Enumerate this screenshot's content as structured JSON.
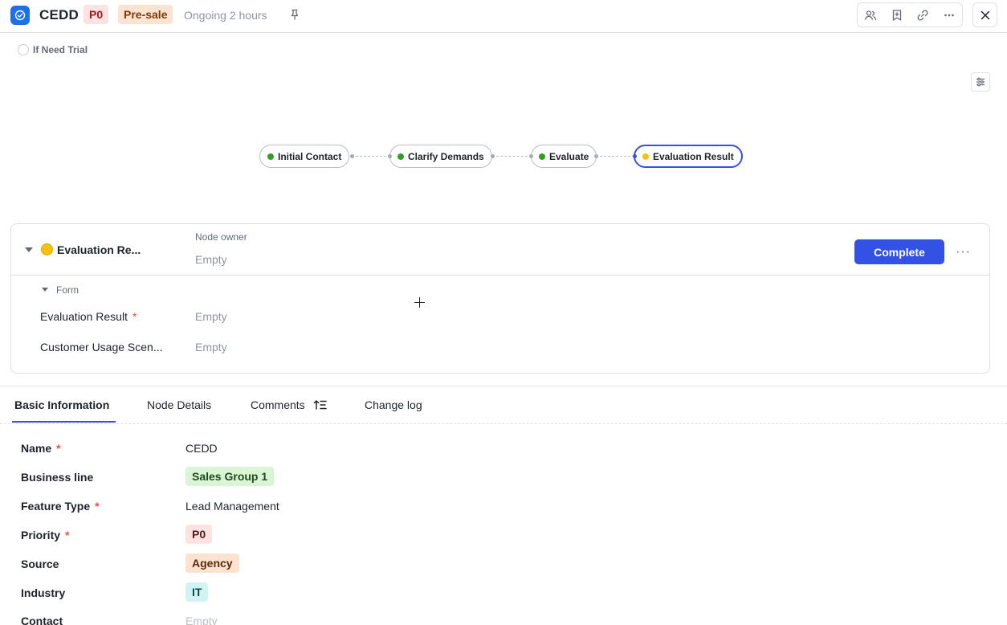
{
  "header": {
    "title": "CEDD",
    "priority_tag": "P0",
    "type_tag": "Pre-sale",
    "status": "Ongoing 2 hours",
    "icons": [
      "members-icon",
      "bookmark-icon",
      "link-icon",
      "more-icon",
      "close-icon"
    ]
  },
  "trial": {
    "label": "If Need Trial"
  },
  "flow": {
    "nodes": [
      {
        "label": "Initial Contact",
        "state": "done"
      },
      {
        "label": "Clarify Demands",
        "state": "done"
      },
      {
        "label": "Evaluate",
        "state": "done"
      },
      {
        "label": "Evaluation Result",
        "state": "active"
      }
    ]
  },
  "panel": {
    "title": "Evaluation Re...",
    "owner_label": "Node owner",
    "owner_value": "Empty",
    "complete_label": "Complete",
    "more_label": "···",
    "form_label": "Form",
    "fields": [
      {
        "label": "Evaluation Result",
        "required": "*",
        "value": "Empty"
      },
      {
        "label": "Customer Usage Scen...",
        "value": "Empty"
      }
    ]
  },
  "tabs": [
    {
      "label": "Basic Information"
    },
    {
      "label": "Node Details"
    },
    {
      "label": "Comments"
    },
    {
      "label": "Change log"
    }
  ],
  "basic_info": {
    "name": {
      "label": "Name",
      "required": "*",
      "value": "CEDD"
    },
    "business_line": {
      "label": "Business line",
      "value": "Sales Group 1"
    },
    "feature_type": {
      "label": "Feature Type",
      "required": "*",
      "value": "Lead Management"
    },
    "priority": {
      "label": "Priority",
      "required": "*",
      "value": "P0"
    },
    "source": {
      "label": "Source",
      "value": "Agency"
    },
    "industry": {
      "label": "Industry",
      "value": "IT"
    },
    "contact": {
      "label": "Contact",
      "value": "Empty"
    }
  },
  "colors": {
    "accent": "#3451e6",
    "done": "#2ea121",
    "active": "#f5c211"
  }
}
